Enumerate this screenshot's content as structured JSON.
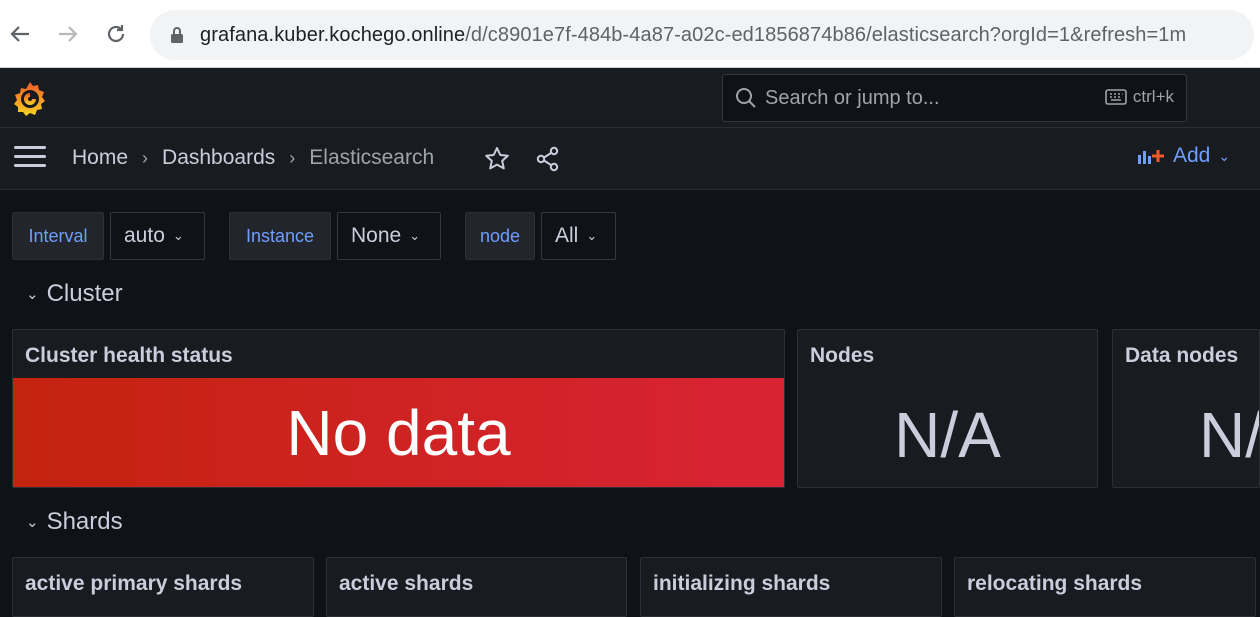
{
  "browser": {
    "url_host": "grafana.kuber.kochego.online",
    "url_path": "/d/c8901e7f-484b-4a87-a02c-ed1856874b86/elasticsearch?orgId=1&refresh=1m"
  },
  "topbar": {
    "search_placeholder": "Search or jump to...",
    "shortcut": "ctrl+k"
  },
  "breadcrumb": {
    "home": "Home",
    "dashboards": "Dashboards",
    "current": "Elasticsearch"
  },
  "toolbar": {
    "add_label": "Add"
  },
  "variables": [
    {
      "label": "Interval",
      "value": "auto"
    },
    {
      "label": "Instance",
      "value": "None"
    },
    {
      "label": "node",
      "value": "All"
    }
  ],
  "rows": {
    "cluster": "Cluster",
    "shards": "Shards"
  },
  "panels": {
    "cluster_health": {
      "title": "Cluster health status",
      "value": "No data"
    },
    "nodes": {
      "title": "Nodes",
      "value": "N/A"
    },
    "data_nodes": {
      "title": "Data nodes",
      "value": "N/A"
    },
    "active_primary": {
      "title": "active primary shards"
    },
    "active": {
      "title": "active shards"
    },
    "initializing": {
      "title": "initializing shards"
    },
    "relocating": {
      "title": "relocating shards"
    }
  },
  "colors": {
    "accent": "#6e9fff",
    "background": "#111217",
    "panel": "#181b1f",
    "critical": "#d92335"
  }
}
